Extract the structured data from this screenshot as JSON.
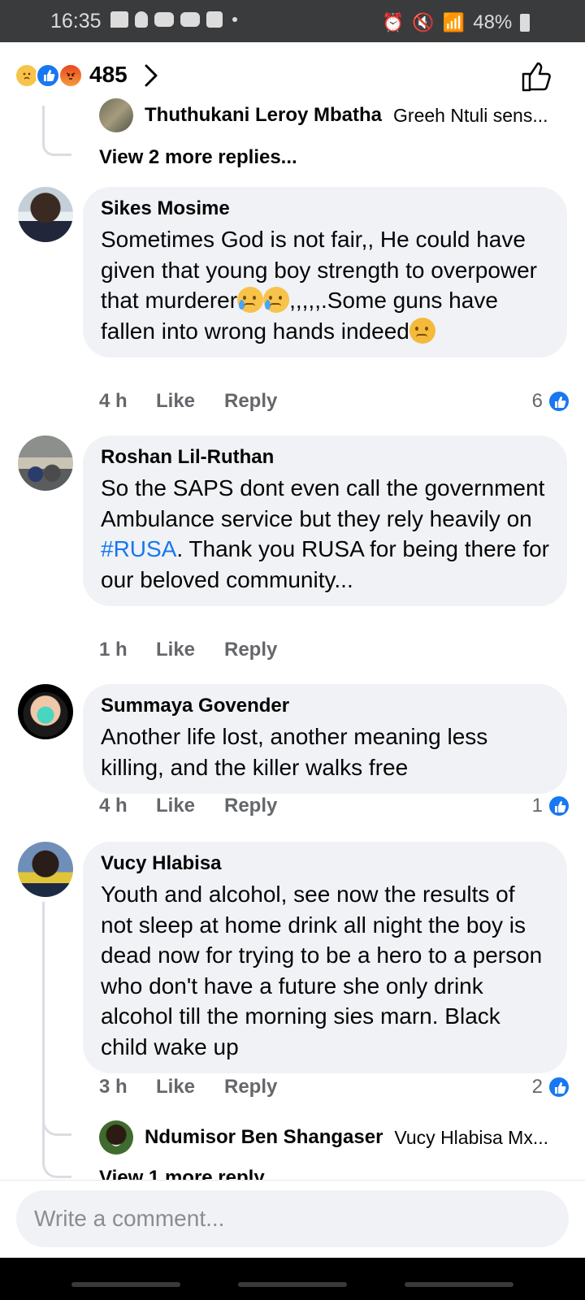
{
  "status_bar": {
    "time": "16:35",
    "battery": "48%"
  },
  "reactions": {
    "count": "485",
    "icons": [
      "sad-reaction-icon",
      "like-reaction-icon",
      "angry-reaction-icon"
    ]
  },
  "thread_top": {
    "reply_name": "Thuthukani Leroy Mbatha",
    "reply_snippet": "Greeh Ntuli sens...",
    "view_more": "View 2 more replies..."
  },
  "comments": [
    {
      "name": "Sikes Mosime",
      "text_parts": [
        "Sometimes God is not fair,, He could have given that young boy strength to overpower that murderer",
        ",,,,,.Some guns have fallen into wrong hands indeed"
      ],
      "time": "4 h",
      "like": "Like",
      "reply": "Reply",
      "likes": "6"
    },
    {
      "name": "Roshan Lil-Ruthan",
      "text_before": "So the SAPS dont even call the government Ambulance service but they rely heavily on ",
      "hashtag": "#RUSA",
      "text_after": ".  Thank you RUSA for being there for our beloved community...",
      "time": "1 h",
      "like": "Like",
      "reply": "Reply",
      "likes": ""
    },
    {
      "name": "Summaya Govender",
      "text": "Another life lost, another meaning less killing, and the killer walks free",
      "time": "4 h",
      "like": "Like",
      "reply": "Reply",
      "likes": "1"
    },
    {
      "name": "Vucy Hlabisa",
      "text": "Youth and alcohol, see now the results of not sleep at home drink all night the boy is dead now for trying to be a hero to a person who don't have a future she only drink alcohol till the morning sies marn. Black child wake up",
      "time": "3 h",
      "like": "Like",
      "reply": "Reply",
      "likes": "2"
    }
  ],
  "thread_bottom": {
    "reply_name": "Ndumisor Ben Shangaser",
    "reply_snippet": "Vucy Hlabisa Mx...",
    "view_more": "View 1 more reply"
  },
  "composer": {
    "placeholder": "Write a comment..."
  },
  "colors": {
    "accent": "#1877f2",
    "bubble": "#f0f2f5",
    "muted_text": "#65676b"
  }
}
